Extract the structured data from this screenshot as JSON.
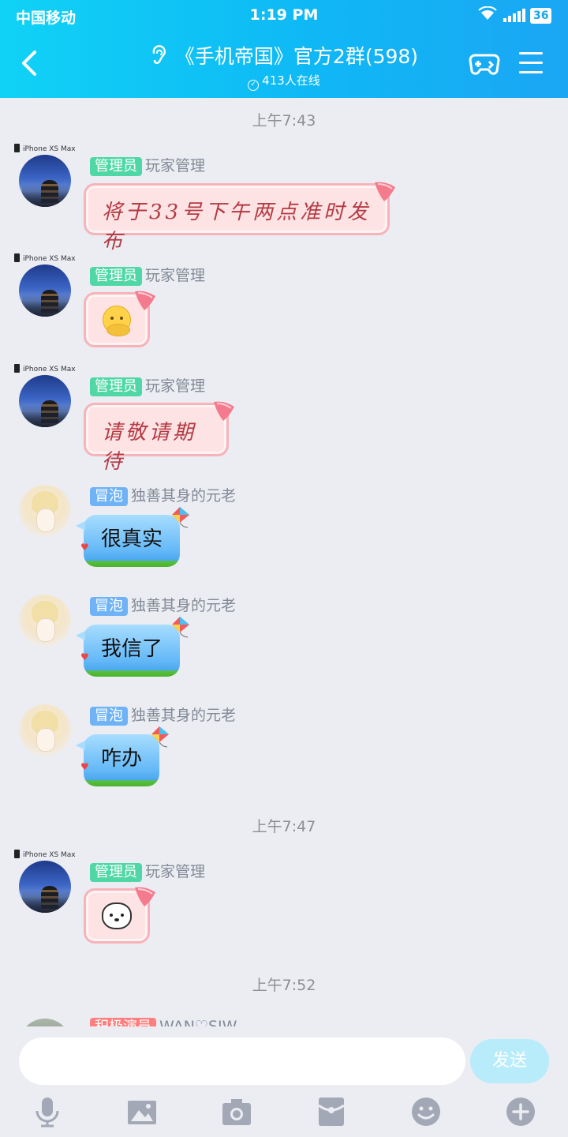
{
  "status": {
    "carrier": "中国移动",
    "time": "1:19 PM",
    "battery": "36"
  },
  "header": {
    "title": "《手机帝国》官方2群(598)",
    "online": "413人在线"
  },
  "timestamps": [
    "上午7:43",
    "上午7:47",
    "上午7:52"
  ],
  "device_label": "iPhone XS Max",
  "messages": [
    {
      "tag": "管理员",
      "name": "玩家管理",
      "text": "将于33号下午两点准时发布"
    },
    {
      "tag": "管理员",
      "name": "玩家管理",
      "emoji": "thinking-face-icon"
    },
    {
      "tag": "管理员",
      "name": "玩家管理",
      "text": "请敬请期待"
    },
    {
      "tag": "冒泡",
      "name": "独善其身的元老",
      "text": "很真实"
    },
    {
      "tag": "冒泡",
      "name": "独善其身的元老",
      "text": "我信了"
    },
    {
      "tag": "冒泡",
      "name": "独善其身的元老",
      "text": "咋办"
    },
    {
      "tag": "管理员",
      "name": "玩家管理",
      "emoji": "bear-face-icon"
    },
    {
      "tag": "积极演员",
      "name": "WAN♡SJW"
    }
  ],
  "composer": {
    "placeholder": "",
    "send_label": "发送"
  },
  "toolbar_icons": [
    "microphone-icon",
    "image-icon",
    "camera-icon",
    "red-packet-icon",
    "emoji-icon",
    "plus-icon"
  ],
  "colors": {
    "header_start": "#10d2f6",
    "header_end": "#1ba6f4",
    "admin_tag": "#4fd8a6",
    "bubble_tag": "#6fb3f6",
    "send_button": "#b8ecfb"
  }
}
